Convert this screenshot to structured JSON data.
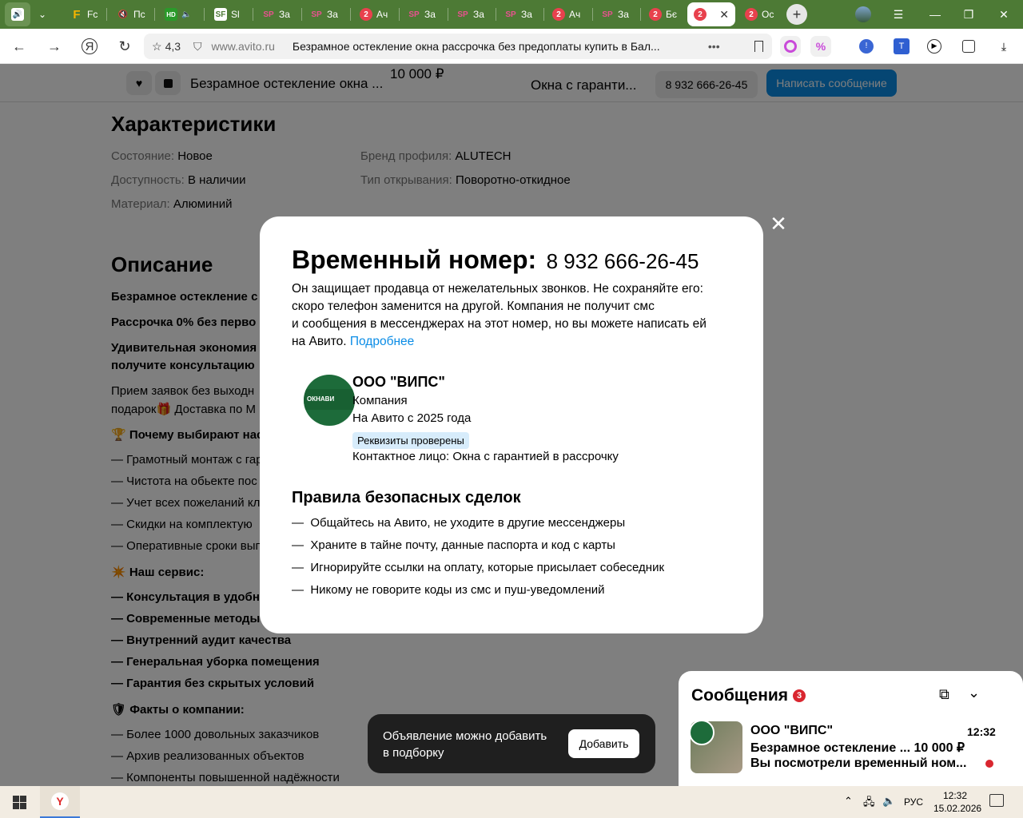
{
  "browser": {
    "tabs": [
      {
        "label": "",
        "icon": "audio-icon"
      },
      {
        "label": "",
        "icon": "chevron-down-icon"
      },
      {
        "label": "Fc",
        "icon": "f-icon"
      },
      {
        "label": "Пс",
        "icon": "mute-icon"
      },
      {
        "label": "",
        "icon": "hd-icon"
      },
      {
        "label": "Sl",
        "icon": "sf-icon"
      },
      {
        "label": "За",
        "icon": "sp-icon"
      },
      {
        "label": "За",
        "icon": "sp-icon"
      },
      {
        "label": "Ач",
        "icon": "avito-icon"
      },
      {
        "label": "За",
        "icon": "sp-icon"
      },
      {
        "label": "За",
        "icon": "sp-icon"
      },
      {
        "label": "За",
        "icon": "sp-icon"
      },
      {
        "label": "Ач",
        "icon": "avito-icon"
      },
      {
        "label": "За",
        "icon": "sp-icon"
      },
      {
        "label": "Бє",
        "icon": "avito-icon"
      },
      {
        "label": "",
        "icon": "avito-icon"
      },
      {
        "label": "Ос",
        "icon": "avito-icon"
      }
    ],
    "tab_badge": "2",
    "rating": "4,3",
    "url": "www.avito.ru",
    "page_title": "Безрамное остекление окна рассрочка без предоплаты купить в Бал..."
  },
  "sticky": {
    "title": "Безрамное остекление окна ...",
    "price": "10 000 ₽",
    "seller": "Окна с гаранти...",
    "phone": "8 932 666-26-45",
    "write_button": "Написать сообщение"
  },
  "characteristics": {
    "heading": "Характеристики",
    "rows": [
      {
        "key": "Состояние:",
        "value": "Новое"
      },
      {
        "key": "Доступность:",
        "value": "В наличии"
      },
      {
        "key": "Материал:",
        "value": "Алюминий"
      },
      {
        "key": "Бренд профиля:",
        "value": "ALUTECH"
      },
      {
        "key": "Тип открывания:",
        "value": "Поворотно-откидное"
      }
    ]
  },
  "description": {
    "heading": "Описание",
    "lines": [
      "Безрамное остекление с",
      "Рассрочка 0% без перво",
      "Удивительная экономия",
      "получите консультацию",
      "Прием заявок без выходн",
      "подарок🎁 Доставка по М",
      "🏆 Почему выбирают нас",
      "— Грамотный монтаж с гар",
      "— Чистота на обьекте пос",
      "— Учет всех пожеланий кл",
      "— Скидки на комплектую",
      "— Оперативные сроки вып",
      "✴️ Наш сервис:",
      "— Консультация в удобно",
      "— Современные методы",
      "— Внутренний аудит качества",
      "— Генеральная уборка помещения",
      "— Гарантия без скрытых условий",
      "🛡 Факты о компании:",
      "— Более 1000 довольных заказчиков",
      "— Архив реализованных объектов",
      "— Компоненты повышенной надёжности"
    ]
  },
  "modal": {
    "title": "Временный номер:",
    "phone": "8 932 666-26-45",
    "text1": "Он защищает продавца от нежелательных звонков. Не сохраняйте его:",
    "text2": "скоро телефон заменится на другой. Компания не получит смс",
    "text3": "и сообщения в мессенджерах на этот номер, но вы можете написать ей",
    "text4": "на Авито.",
    "more_link": "Подробнее",
    "company_name": "ООО \"ВИПС\"",
    "company_type": "Компания",
    "since": "На Авито с 2025 года",
    "verified": "Реквизиты проверены",
    "contact": "Контактное лицо: Окна с гарантией в рассрочку",
    "logo_text": "ОКНАВИ",
    "rules_heading": "Правила безопасных сделок",
    "rules": [
      "Общайтесь на Авито, не уходите в другие мессенджеры",
      "Храните в тайне почту, данные паспорта и код с карты",
      "Игнорируйте ссылки на оплату, которые присылает собеседник",
      "Никому не говорите коды из смс и пуш-уведомлений"
    ]
  },
  "toast": {
    "text1": "Объявление можно добавить",
    "text2": "в подборку",
    "button": "Добавить"
  },
  "messages": {
    "heading": "Сообщения",
    "count": "3",
    "sender": "ООО \"ВИПС\"",
    "time": "12:32",
    "subject": "Безрамное остекление ...",
    "price": "10 000 ₽",
    "preview": "Вы посмотрели временный ном..."
  },
  "taskbar": {
    "lang": "РУС",
    "time": "12:32",
    "date": "15.02.2026"
  },
  "colors": {
    "accent": "#0a8ce6",
    "tabbar": "#4d7a35",
    "link": "#0a8ce6",
    "badge": "#d9262f",
    "verified_bg": "#d7ecfb"
  }
}
